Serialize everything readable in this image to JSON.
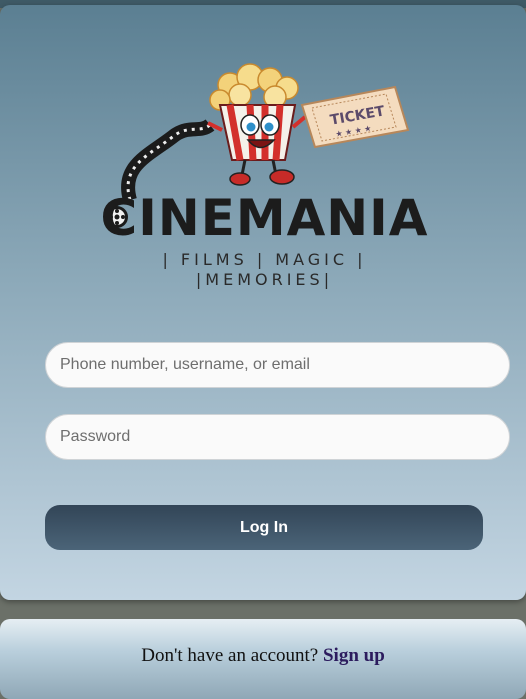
{
  "brand": {
    "name": "CINEMANIA",
    "tagline_line1": "| FILMS | MAGIC |",
    "tagline_line2": "|MEMORIES|",
    "ticket_text": "TICKET"
  },
  "login": {
    "username_placeholder": "Phone number, username, or email",
    "password_placeholder": "Password",
    "login_label": "Log In"
  },
  "signup": {
    "prompt": "Don't have an account? ",
    "link_label": "Sign up"
  },
  "colors": {
    "button": "#324557",
    "signup_link": "#2c1c5e"
  }
}
